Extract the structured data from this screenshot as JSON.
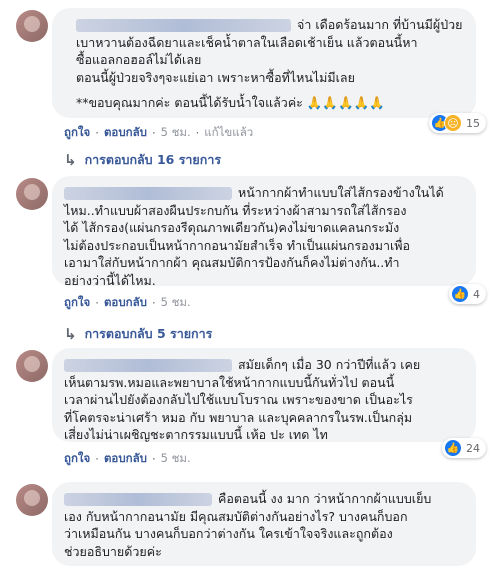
{
  "comments": [
    {
      "text_lines": [
        "จ่า เดือดร้อนมาก ที่บ้านมีผู้ป่วย",
        "เบาหวานต้องฉีดยาและเช็คน้ำตาลในเลือดเช้าเย็น แล้วตอนนี้หา",
        "ซื้อแอลกอฮอล์ไม่ได้เลย",
        "ตอนนี้ผู้ป่วยจริงๆจะแย่เอา เพราะหาซื้อที่ไหนไม่มีเลย",
        "",
        "**ขอบคุณมากค่ะ ตอนนี้ได้รับน้ำใจแล้วค่ะ 🙏🙏🙏🙏🙏"
      ],
      "reaction_count": "15",
      "actions": {
        "like": "ถูกใจ",
        "reply": "ตอบกลับ",
        "time": "5 ชม.",
        "edited": "แก้ไขแล้ว"
      },
      "replies_label": "การตอบกลับ 16 รายการ"
    },
    {
      "text_lines": [
        "หน้ากากผ้าทำแบบใส่ไส้กรองข้างในได้",
        "ไหม..ทำแบบผ้าสองผืนประกบกัน ที่ระหว่างผ้าสามารถใส่ไส้กรอง",
        "ได้ ไส้กรอง(แผ่นกรองรีดุณภาพเดียวกัน)คงไม่ขาดแคลนกระมัง",
        "ไม่ต้องประกอบเป็นหน้ากากอนามัยสำเร็จ ทำเป็นแผ่นกรองมาเพื่อ",
        "เอามาใส่กับหน้ากากผ้า คุณสมบัติการป้องกันก็คงไม่ต่างกัน..ทำ",
        "อย่างว่านี้ได้ไหม."
      ],
      "reaction_count": "4",
      "actions": {
        "like": "ถูกใจ",
        "reply": "ตอบกลับ",
        "time": "5 ชม."
      },
      "replies_label": "การตอบกลับ 5 รายการ"
    },
    {
      "text_lines": [
        "สมัยเด็กๆ เมื่อ 30 กว่าปีที่แล้ว เคย",
        "เห็นตามรพ.หมอและพยาบาลใช้หน้ากากแบบนี้กันทั่วไป ตอนนี้",
        "เวลาผ่านไปยังต้องกลับไปใช้แบบโบราณ เพราะของขาด เป็นอะไร",
        "ที่โคตรจะน่าเศร้า หมอ กับ พยาบาล และบุคคลากรในรพ.เป็นกลุ่ม",
        "เสี่ยงไม่น่าเผชิญชะตากรรมแบบนี้ เห้อ ปะ เทด ไท"
      ],
      "reaction_count": "24",
      "actions": {
        "like": "ถูกใจ",
        "reply": "ตอบกลับ",
        "time": "5 ชม."
      }
    },
    {
      "text_lines": [
        "คือตอนนี้ งง มาก ว่าหน้ากากผ้าแบบเย็บ",
        "เอง กับหน้ากากอนามัย มีคุณสมบัติต่างกันอย่างไร? บางคนก็บอก",
        "ว่าเหมือนกัน บางคนก็บอกว่าต่างกัน ใครเข้าใจจริงและถูกต้อง",
        "ช่วยอธิบายด้วยค่ะ"
      ]
    }
  ]
}
